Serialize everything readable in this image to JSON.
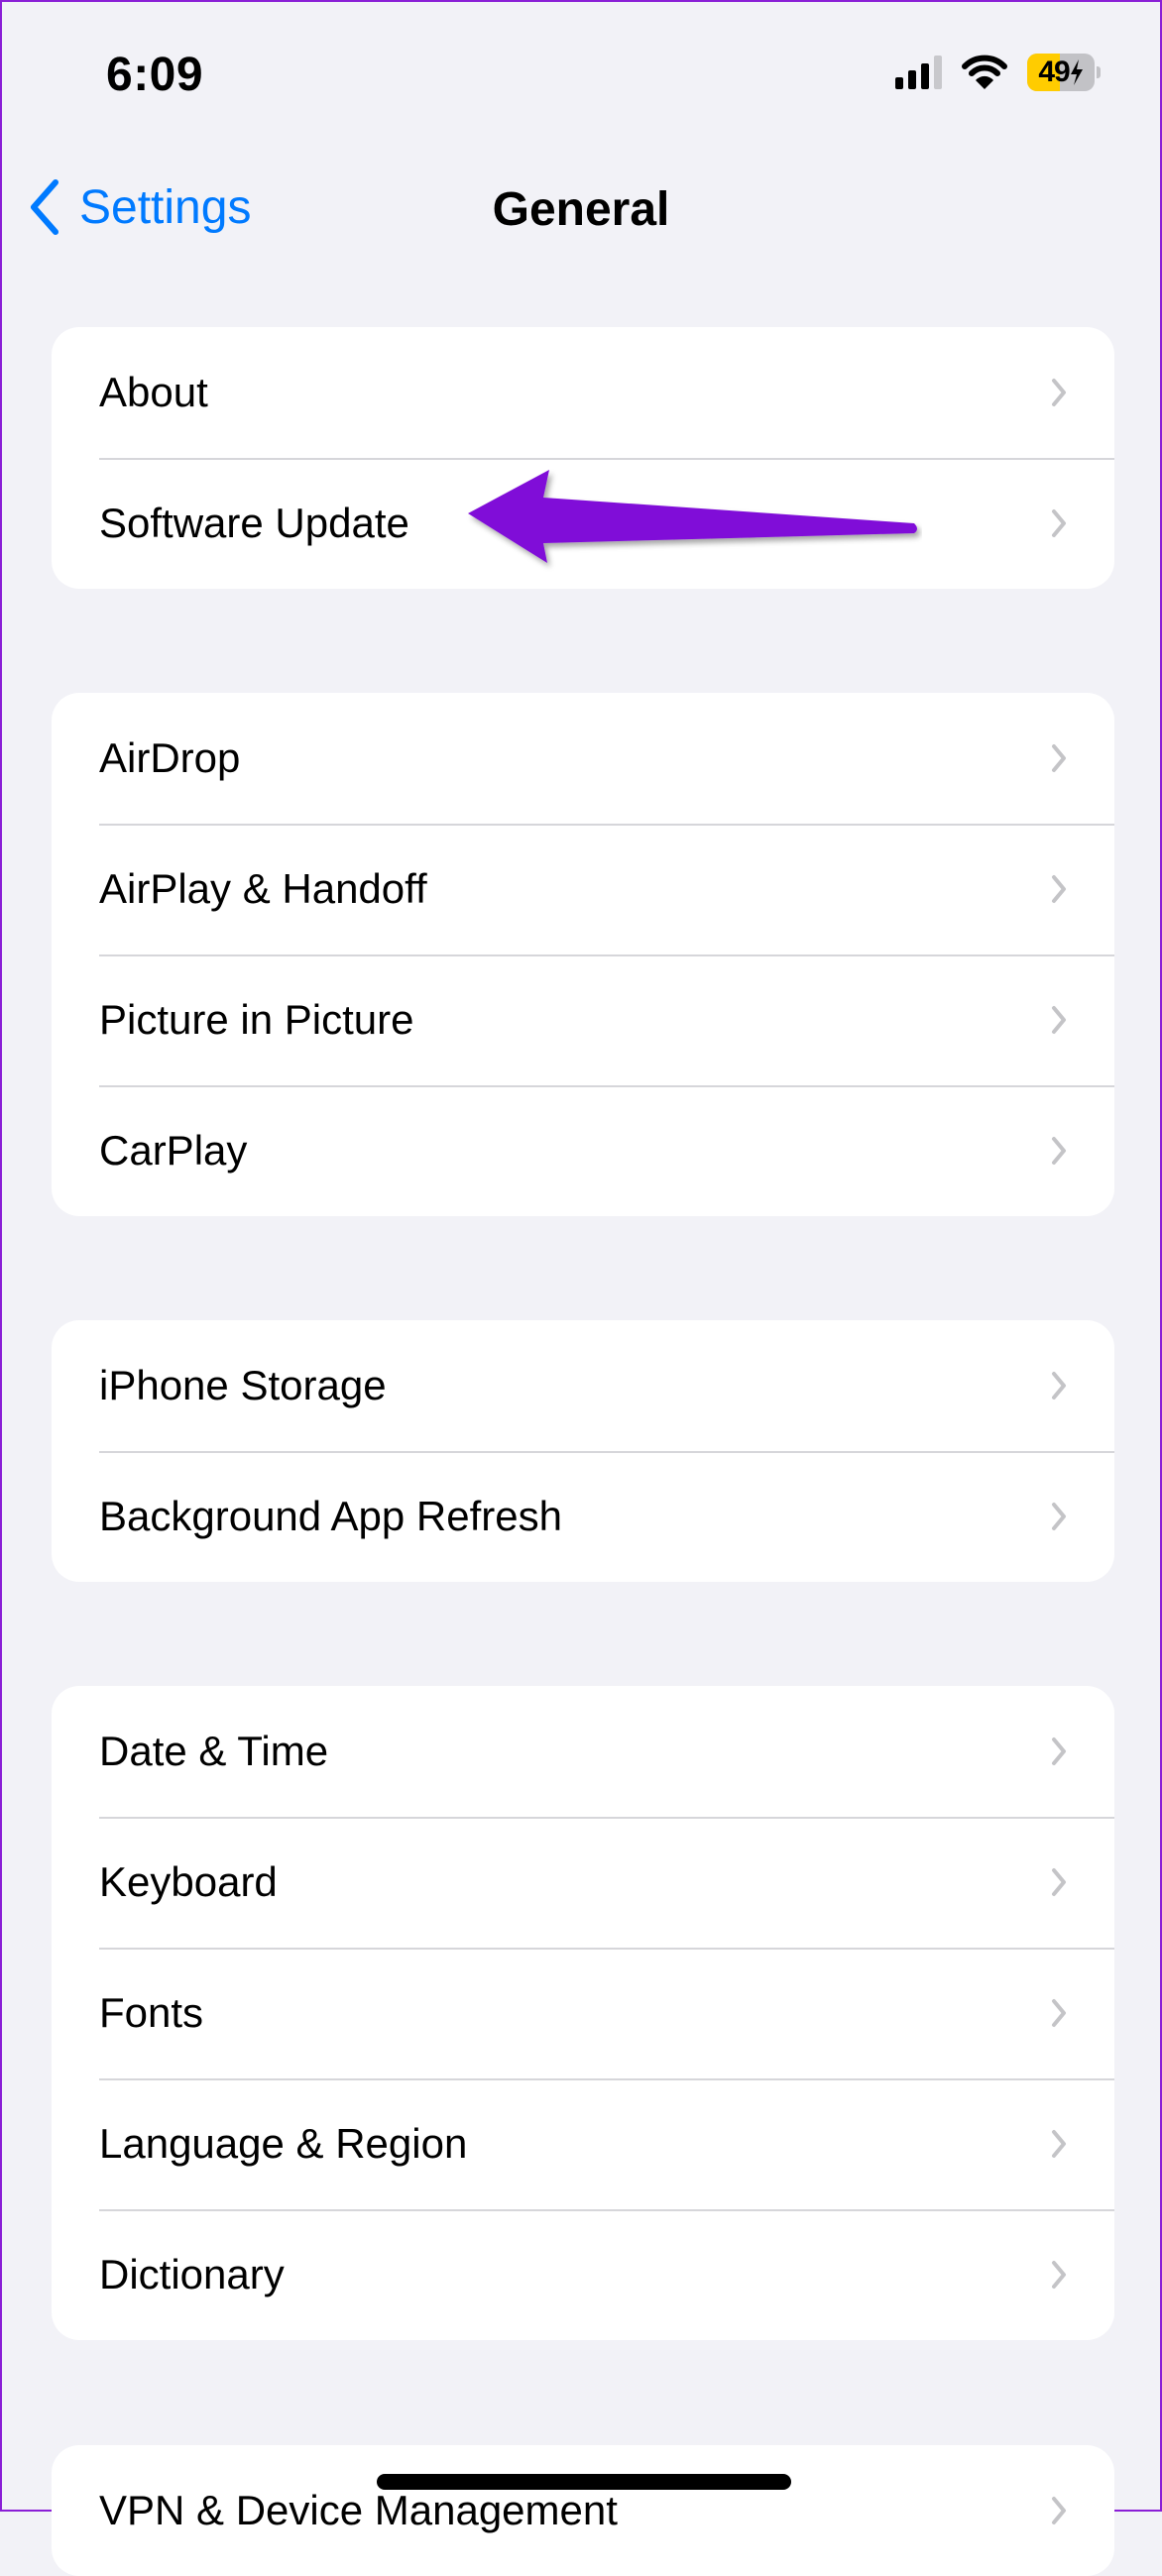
{
  "status_bar": {
    "time": "6:09",
    "battery_percent": "49",
    "battery_level": 0.49,
    "battery_charging": true,
    "signal_bars_active": 3,
    "signal_bars_total": 4,
    "icons": [
      "cellular-signal-icon",
      "wifi-icon",
      "battery-icon",
      "charging-bolt-icon"
    ]
  },
  "nav": {
    "back_label": "Settings",
    "title": "General"
  },
  "groups": [
    {
      "rows": [
        {
          "label": "About"
        },
        {
          "label": "Software Update"
        }
      ]
    },
    {
      "rows": [
        {
          "label": "AirDrop"
        },
        {
          "label": "AirPlay & Handoff"
        },
        {
          "label": "Picture in Picture"
        },
        {
          "label": "CarPlay"
        }
      ]
    },
    {
      "rows": [
        {
          "label": "iPhone Storage"
        },
        {
          "label": "Background App Refresh"
        }
      ]
    },
    {
      "rows": [
        {
          "label": "Date & Time"
        },
        {
          "label": "Keyboard"
        },
        {
          "label": "Fonts"
        },
        {
          "label": "Language & Region"
        },
        {
          "label": "Dictionary"
        }
      ]
    },
    {
      "rows": [
        {
          "label": "VPN & Device Management"
        }
      ]
    }
  ],
  "annotation": {
    "type": "arrow",
    "points_to": "Software Update",
    "color": "#8010d8"
  },
  "colors": {
    "accent": "#007aff",
    "background": "#f2f2f7",
    "battery_low": "#ffcc00"
  }
}
